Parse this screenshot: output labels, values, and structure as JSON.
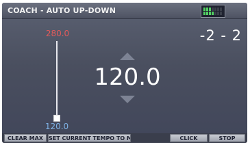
{
  "header": {
    "title": "COACH - AUTO UP-DOWN"
  },
  "score": "-2 - 2",
  "slider": {
    "max_value": "280.0",
    "min_value": "120.0"
  },
  "tempo": {
    "value": "120.0"
  },
  "footer": {
    "clear_max_label": "CLEAR MAX",
    "set_current_tempo_label": "SET CURRENT TEMPO TO MAX",
    "click_label": "CLICK",
    "stop_label": "STOP"
  },
  "colors": {
    "background": "#4a4f5f",
    "max_label": "#e45a5a",
    "min_label": "#7fb2e6",
    "meter_on": "#53d063"
  },
  "icons": {
    "meter": "level-meter-icon",
    "tempo_up": "triangle-up-icon",
    "tempo_down": "triangle-down-icon"
  }
}
